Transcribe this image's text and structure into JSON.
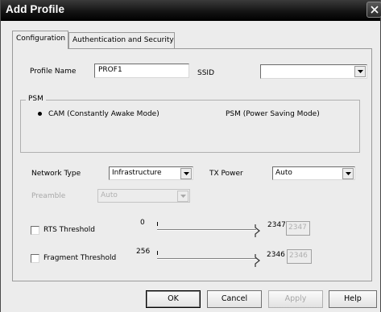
{
  "window": {
    "title": "Add Profile"
  },
  "tabs": [
    {
      "label": "Configuration"
    },
    {
      "label": "Authentication and Security"
    }
  ],
  "config": {
    "profile_name_label": "Profile Name",
    "profile_name_value": "PROF1",
    "ssid_label": "SSID",
    "ssid_value": "",
    "psm": {
      "group_title": "PSM",
      "cam_label": "CAM (Constantly Awake Mode)",
      "psm_label": "PSM (Power Saving Mode)",
      "selected": "CAM (Constantly Awake Mode)"
    },
    "network_type_label": "Network Type",
    "network_type_value": "Infrastructure",
    "tx_power_label": "TX Power",
    "tx_power_value": "Auto",
    "preamble_label": "Preamble",
    "preamble_value": "Auto",
    "rts": {
      "label": "RTS Threshold",
      "checked": false,
      "min": "0",
      "max": "2347",
      "value": "2347"
    },
    "fragment": {
      "label": "Fragment Threshold",
      "checked": false,
      "min": "256",
      "max": "2346",
      "value": "2346"
    }
  },
  "buttons": {
    "ok": "OK",
    "cancel": "Cancel",
    "apply": "Apply",
    "help": "Help"
  },
  "icons": {
    "close": "close-icon",
    "dropdown": "chevron-down-icon"
  }
}
